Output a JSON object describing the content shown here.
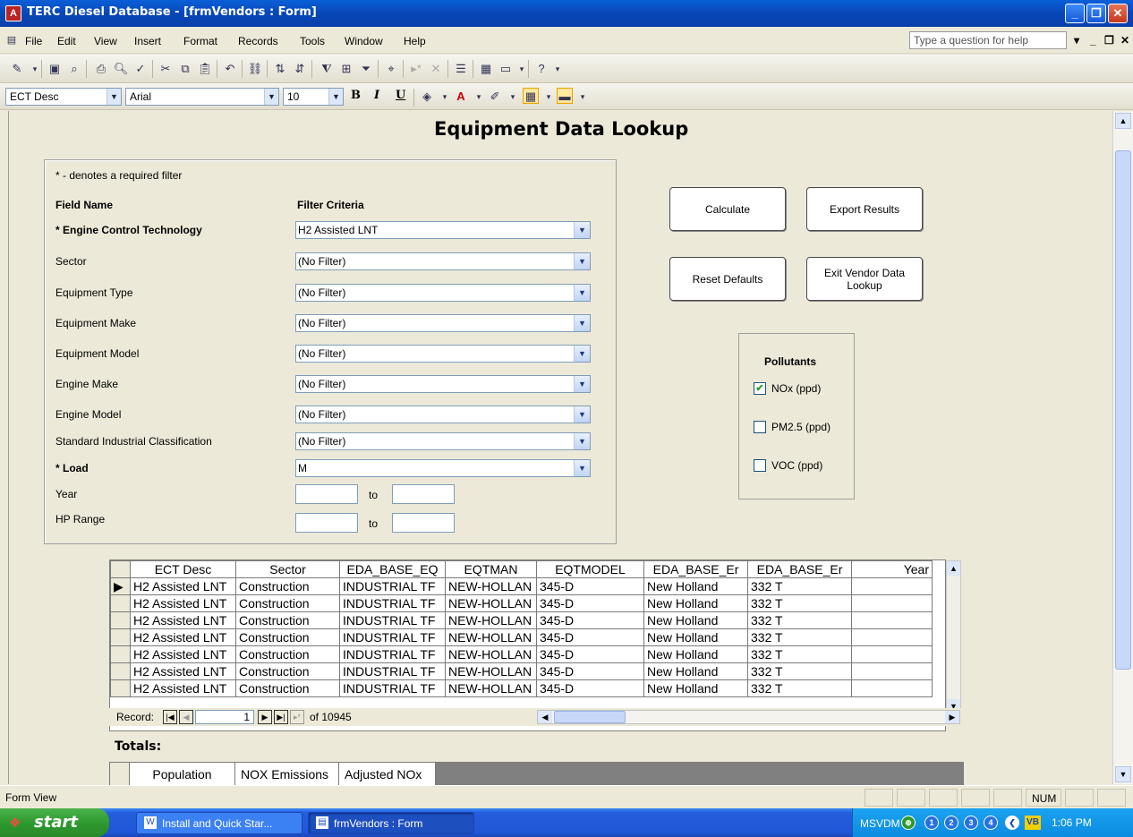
{
  "window": {
    "title": "TERC Diesel Database - [frmVendors : Form]"
  },
  "menu": {
    "items": [
      "File",
      "Edit",
      "View",
      "Insert",
      "Format",
      "Records",
      "Tools",
      "Window",
      "Help"
    ],
    "help_placeholder": "Type a question for help"
  },
  "format_toolbar": {
    "object": "ECT Desc",
    "font": "Arial",
    "size": "10",
    "bold": "B",
    "italic": "I",
    "underline": "U"
  },
  "form": {
    "title": "Equipment Data Lookup",
    "required_note": "* - denotes a required filter",
    "field_name_header": "Field Name",
    "filter_criteria_header": "Filter Criteria",
    "filters": [
      {
        "label": "* Engine Control Technology",
        "value": "H2 Assisted LNT",
        "required": true
      },
      {
        "label": "Sector",
        "value": "(No Filter)",
        "required": false
      },
      {
        "label": "Equipment Type",
        "value": "(No Filter)",
        "required": false
      },
      {
        "label": "Equipment Make",
        "value": "(No Filter)",
        "required": false
      },
      {
        "label": "Equipment Model",
        "value": "(No Filter)",
        "required": false
      },
      {
        "label": "Engine Make",
        "value": "(No Filter)",
        "required": false
      },
      {
        "label": "Engine Model",
        "value": "(No Filter)",
        "required": false
      },
      {
        "label": "Standard Industrial Classification",
        "value": "(No Filter)",
        "required": false
      },
      {
        "label": "* Load",
        "value": "M",
        "required": true
      }
    ],
    "year_label": "Year",
    "hp_label": "HP Range",
    "to_label": "to",
    "buttons": {
      "calculate": "Calculate",
      "export": "Export Results",
      "reset": "Reset Defaults",
      "exit": "Exit Vendor Data Lookup"
    },
    "pollutants": {
      "title": "Pollutants",
      "items": [
        {
          "label": "NOx (ppd)",
          "checked": true
        },
        {
          "label": "PM2.5 (ppd)",
          "checked": false
        },
        {
          "label": "VOC (ppd)",
          "checked": false
        }
      ]
    },
    "grid": {
      "columns": [
        "ECT Desc",
        "Sector",
        "EDA_BASE_EQ",
        "EQTMAN",
        "EQTMODEL",
        "EDA_BASE_Er",
        "EDA_BASE_Er",
        "Year"
      ],
      "rows": [
        [
          "H2 Assisted LNT",
          "Construction",
          "INDUSTRIAL TF",
          "NEW-HOLLAN",
          "345-D",
          "New Holland",
          "332 T",
          ""
        ],
        [
          "H2 Assisted LNT",
          "Construction",
          "INDUSTRIAL TF",
          "NEW-HOLLAN",
          "345-D",
          "New Holland",
          "332 T",
          ""
        ],
        [
          "H2 Assisted LNT",
          "Construction",
          "INDUSTRIAL TF",
          "NEW-HOLLAN",
          "345-D",
          "New Holland",
          "332 T",
          ""
        ],
        [
          "H2 Assisted LNT",
          "Construction",
          "INDUSTRIAL TF",
          "NEW-HOLLAN",
          "345-D",
          "New Holland",
          "332 T",
          ""
        ],
        [
          "H2 Assisted LNT",
          "Construction",
          "INDUSTRIAL TF",
          "NEW-HOLLAN",
          "345-D",
          "New Holland",
          "332 T",
          ""
        ],
        [
          "H2 Assisted LNT",
          "Construction",
          "INDUSTRIAL TF",
          "NEW-HOLLAN",
          "345-D",
          "New Holland",
          "332 T",
          ""
        ],
        [
          "H2 Assisted LNT",
          "Construction",
          "INDUSTRIAL TF",
          "NEW-HOLLAN",
          "345-D",
          "New Holland",
          "332 T",
          ""
        ]
      ],
      "record_label": "Record:",
      "record_current": "1",
      "record_of": "of 10945"
    },
    "totals": {
      "title": "Totals:",
      "columns": [
        "Population",
        "NOX Emissions",
        "Adjusted NOx"
      ]
    }
  },
  "status": {
    "left": "Form View",
    "num": "NUM"
  },
  "taskbar": {
    "start": "start",
    "tasks": [
      "Install and Quick Star...",
      "frmVendors : Form"
    ],
    "tray_label": "MSVDM",
    "tray_nums": [
      "1",
      "2",
      "3",
      "4"
    ],
    "time": "1:06 PM"
  }
}
